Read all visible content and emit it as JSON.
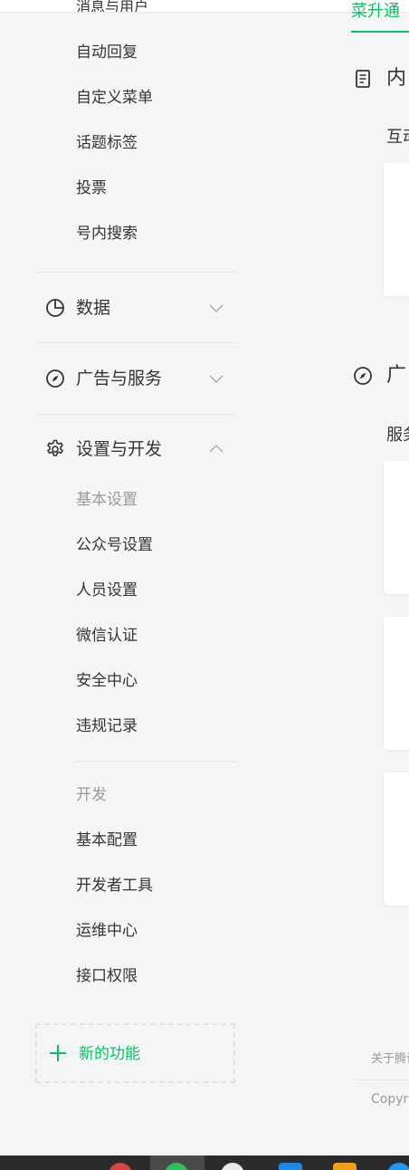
{
  "topband": {
    "cut_text": "消息与用户"
  },
  "sidebar": {
    "interaction_items": [
      "自动回复",
      "自定义菜单",
      "话题标签",
      "投票",
      "号内搜索"
    ],
    "sections": {
      "data": {
        "label": "数据",
        "icon": "pie-chart-icon",
        "expanded": false
      },
      "ads": {
        "label": "广告与服务",
        "icon": "compass-icon",
        "expanded": false
      },
      "settings": {
        "label": "设置与开发",
        "icon": "gear-icon",
        "expanded": true
      }
    },
    "basic_settings": {
      "title": "基本设置",
      "items": [
        "公众号设置",
        "人员设置",
        "微信认证",
        "安全中心",
        "违规记录"
      ]
    },
    "dev": {
      "title": "开发",
      "items": [
        "基本配置",
        "开发者工具",
        "运维中心",
        "接口权限"
      ]
    },
    "new_feature": {
      "label": "新的功能",
      "icon": "plus-icon"
    }
  },
  "main": {
    "tab_label": "菜升通",
    "content_section": {
      "title": "内",
      "icon": "document-icon",
      "subtitle": "互动"
    },
    "ads_section": {
      "title": "广",
      "icon": "compass-icon",
      "subtitle": "服务"
    },
    "footer": {
      "link": "关于腾讯",
      "copyright": "Copyright"
    }
  },
  "colors": {
    "accent": "#07c160",
    "text": "#353535",
    "muted": "#9a9a9a",
    "bg": "#f4f5f7"
  }
}
